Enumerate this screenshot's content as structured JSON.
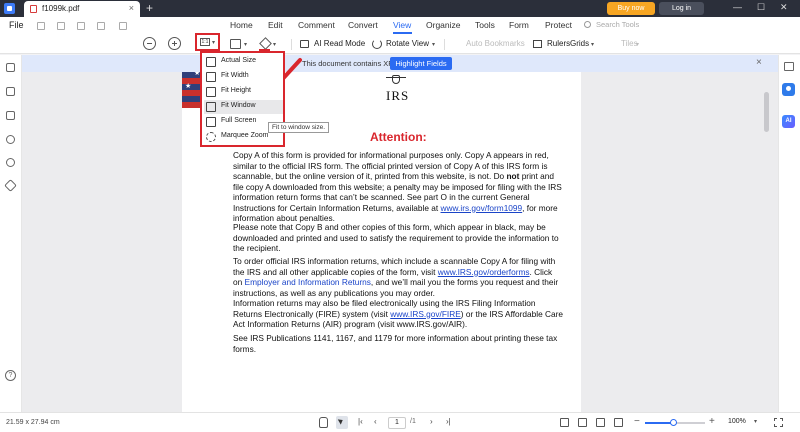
{
  "titlebar": {
    "tab_title": "f1099k.pdf",
    "tab_close": "×",
    "new_tab": "+",
    "buy_now": "Buy now",
    "login": "Log in",
    "minimize": "—",
    "maximize": "☐",
    "close": "✕"
  },
  "menubar": {
    "file": "File",
    "items": [
      "Home",
      "Edit",
      "Comment",
      "Convert",
      "View",
      "Organize",
      "Tools",
      "Form",
      "Protect"
    ],
    "active": "View",
    "search_placeholder": "Search Tools"
  },
  "toolbar": {
    "fit_icon_text": "1:1",
    "ai_read_mode": "AI Read Mode",
    "rotate_view": "Rotate View",
    "auto_bookmarks": "Auto Bookmarks",
    "rulers": "Rulers",
    "grids": "Grids",
    "tiles": "Tiles",
    "caret": "▾"
  },
  "banner": {
    "text": "This document contains XFA form fields.",
    "button": "Highlight Fields",
    "close": "×"
  },
  "dropdown": {
    "items": [
      "Actual Size",
      "Fit Width",
      "Fit Height",
      "Fit Window",
      "Full Screen",
      "Marquee Zoom"
    ],
    "active_index": 3,
    "tooltip": "Fit to window size."
  },
  "document": {
    "irs": "IRS",
    "attention": "Attention:",
    "p1": {
      "a": "Copy A of this form is provided for informational purposes only. Copy A appears in red, similar to the official IRS form. The official printed version of Copy A of this IRS form is scannable, but the online version of it, printed from this website, is not. Do ",
      "bold": "not",
      "b": " print and file copy A downloaded from this website; a penalty may be imposed for filing with the IRS information return forms that can’t be scanned. See part O in the current General Instructions for Certain Information Returns, available at ",
      "link": "www.irs.gov/form1099",
      "c": ", for more information about penalties."
    },
    "p2": "Please note that Copy B and other copies of this form, which appear in black, may be downloaded and printed and used to satisfy the requirement to provide the information to the recipient.",
    "p3": {
      "a": "To order official IRS information returns, which include a scannable Copy A for filing with the IRS and all other applicable copies of the form, visit ",
      "link1": "www.IRS.gov/orderforms",
      "b": ". Click on ",
      "link2": "Employer and Information Returns",
      "c": ", and we’ll mail you the forms you request and their instructions, as well as any publications you may order."
    },
    "p4": {
      "a": "Information returns may also be filed electronically using the IRS Filing Information Returns Electronically (FIRE) system (visit ",
      "link": "www.IRS.gov/FIRE",
      "b": ") or the IRS Affordable Care Act Information Returns (AIR) program (visit www.IRS.gov/AIR)."
    },
    "p5": "See IRS Publications 1141, 1167, and 1179 for more information about printing these tax forms."
  },
  "statusbar": {
    "page_size": "21.59 x 27.94 cm",
    "current_page": "1",
    "total_pages": "/1",
    "zoom": "100%",
    "zoom_caret": "▾",
    "zoom_slider_fraction": 0.48,
    "nav_first": "|‹",
    "nav_prev": "‹",
    "nav_next": "›",
    "nav_last": "›|"
  },
  "colors": {
    "accent": "#2b6bf2",
    "highlight_red": "#d9262d",
    "buy_now": "#f7a623"
  },
  "icons": {
    "left_sidebar": [
      "page-icon",
      "bookmark-icon",
      "comment-icon",
      "attachment-icon",
      "search-icon",
      "layers-icon"
    ],
    "right_sidebar": [
      "properties-icon",
      "user-panel-icon",
      "ai-assistant-icon"
    ]
  }
}
